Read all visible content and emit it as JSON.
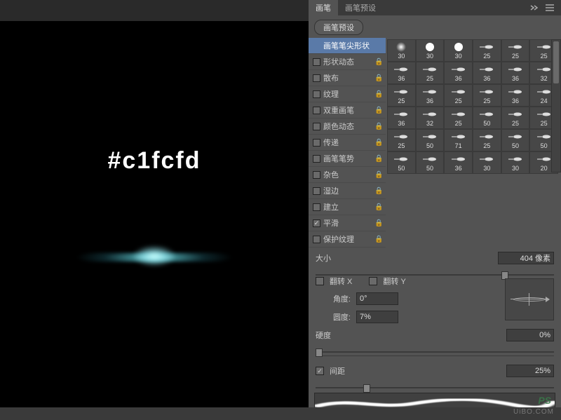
{
  "canvas": {
    "hex_label": "#c1fcfd"
  },
  "panel": {
    "tabs": {
      "brush": "画笔",
      "presets": "画笔预设"
    },
    "preset_button": "画笔预设",
    "options": [
      {
        "label": "画笔笔尖形状",
        "checked": null,
        "locked": false,
        "selected": true
      },
      {
        "label": "形状动态",
        "checked": false,
        "locked": true
      },
      {
        "label": "散布",
        "checked": false,
        "locked": true
      },
      {
        "label": "纹理",
        "checked": false,
        "locked": true
      },
      {
        "label": "双重画笔",
        "checked": false,
        "locked": true
      },
      {
        "label": "颜色动态",
        "checked": false,
        "locked": true
      },
      {
        "label": "传递",
        "checked": false,
        "locked": true
      },
      {
        "label": "画笔笔势",
        "checked": false,
        "locked": true
      },
      {
        "label": "杂色",
        "checked": false,
        "locked": true
      },
      {
        "label": "湿边",
        "checked": false,
        "locked": true
      },
      {
        "label": "建立",
        "checked": false,
        "locked": true
      },
      {
        "label": "平滑",
        "checked": true,
        "locked": true
      },
      {
        "label": "保护纹理",
        "checked": false,
        "locked": true
      }
    ],
    "brushes": [
      {
        "size": "30",
        "t": "soft"
      },
      {
        "size": "30",
        "t": "hard"
      },
      {
        "size": "30",
        "t": "hard"
      },
      {
        "size": "25",
        "t": "flat"
      },
      {
        "size": "25",
        "t": "flat"
      },
      {
        "size": "25",
        "t": "flat"
      },
      {
        "size": "36",
        "t": "flat"
      },
      {
        "size": "25",
        "t": "flat"
      },
      {
        "size": "36",
        "t": "flat"
      },
      {
        "size": "36",
        "t": "flat"
      },
      {
        "size": "36",
        "t": "flat"
      },
      {
        "size": "32",
        "t": "flat"
      },
      {
        "size": "25",
        "t": "flat"
      },
      {
        "size": "36",
        "t": "flat"
      },
      {
        "size": "25",
        "t": "flat"
      },
      {
        "size": "25",
        "t": "flat"
      },
      {
        "size": "36",
        "t": "flat"
      },
      {
        "size": "24",
        "t": "flat"
      },
      {
        "size": "36",
        "t": "flat"
      },
      {
        "size": "32",
        "t": "flat"
      },
      {
        "size": "25",
        "t": "flat"
      },
      {
        "size": "50",
        "t": "flat"
      },
      {
        "size": "25",
        "t": "flat"
      },
      {
        "size": "25",
        "t": "flat"
      },
      {
        "size": "25",
        "t": "flat"
      },
      {
        "size": "50",
        "t": "flat"
      },
      {
        "size": "71",
        "t": "flat"
      },
      {
        "size": "25",
        "t": "flat"
      },
      {
        "size": "50",
        "t": "flat"
      },
      {
        "size": "50",
        "t": "flat"
      },
      {
        "size": "50",
        "t": "flat"
      },
      {
        "size": "50",
        "t": "flat"
      },
      {
        "size": "36",
        "t": "flat"
      },
      {
        "size": "30",
        "t": "flat"
      },
      {
        "size": "30",
        "t": "flat"
      },
      {
        "size": "20",
        "t": "flat"
      }
    ],
    "size_label": "大小",
    "size_value": "404 像素",
    "flipx_label": "翻转 X",
    "flipy_label": "翻转 Y",
    "angle_label": "角度:",
    "angle_value": "0°",
    "roundness_label": "圆度:",
    "roundness_value": "7%",
    "hardness_label": "硬度",
    "hardness_value": "0%",
    "spacing_label": "间距",
    "spacing_value": "25%"
  },
  "watermark": {
    "logo": "PS",
    "url": "UiBO.COM"
  }
}
